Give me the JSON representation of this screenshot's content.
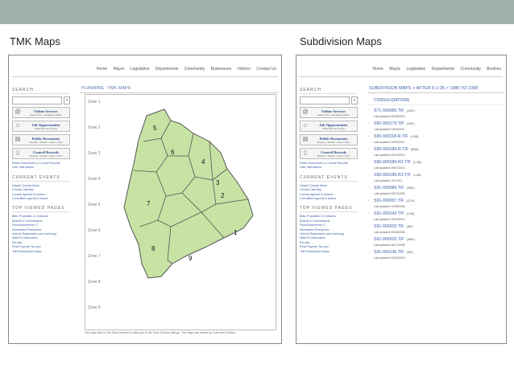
{
  "slide": {
    "left_title": "TMK Maps",
    "right_title": "Subdivision Maps",
    "topbar_color": "#9eb1a9"
  },
  "nav_items": [
    "Home",
    "Mayor",
    "Legislative",
    "Departments",
    "Community",
    "Businesses",
    "Visitors",
    "Contact Us"
  ],
  "nav_items_right": [
    "Home",
    "Mayor",
    "Legislative",
    "Departments",
    "Community",
    "Busines"
  ],
  "sidebar": {
    "search_label": "SEARCH",
    "search_button": "»",
    "services": [
      {
        "icon": "at-sign-icon",
        "glyph": "@",
        "title": "Online Services",
        "sub": "Save Time • Complete Online"
      },
      {
        "icon": "person-icon",
        "glyph": "☺",
        "title": "Job Opportunities",
        "sub": "What Fits the County"
      },
      {
        "icon": "folder-icon",
        "glyph": "▤",
        "title": "Public Documents",
        "sub": "Browse • Search • View • Print"
      },
      {
        "icon": "document-icon",
        "glyph": "▯",
        "title": "Council Records",
        "sub": "Browse • Search • View • Print"
      }
    ],
    "records_links": [
      "Public Documents & Council Records",
      "User Instructions"
    ],
    "current_events_title": "CURRENT EVENTS",
    "current_events": [
      "Hawai'i County News",
      "County Calendar",
      "Council Agenda & Actions",
      "Committee Agenda & Action"
    ],
    "top_viewed_title": "TOP VIEWED PAGES",
    "top_viewed": [
      "Bids, Proposals & Contracts",
      "Boards & Commissions",
      "Fiscal Awareness IT",
      "Information Resources",
      "Vehicle Registration and Licensing",
      "State ID Information",
      "Permits",
      "Real Property Tax and",
      "TMK/Subdivision Maps"
    ]
  },
  "tmk": {
    "heading": "PLANNING : TMK MAPS",
    "zones": [
      "Zone 1",
      "Zone 2",
      "Zone 3",
      "Zone 4",
      "Zone 5",
      "Zone 6",
      "Zone 7",
      "Zone 8",
      "Zone 9"
    ],
    "map_numbers": [
      "1",
      "2",
      "3",
      "4",
      "5",
      "6",
      "7",
      "8",
      "9"
    ],
    "map_fill": "#c6e3a4",
    "map_stroke": "#555555",
    "footer_note": "You may click on the Zone number to take you to the Zone Section listings. The maps are sorted by Zone and Section."
  },
  "subdivision": {
    "heading": "SUBDIVISION MAPS > AFTER 6-1-05 > 1980 TO 1999",
    "consolidations": "CONSOLIDATIONS",
    "files": [
      {
        "name": "S71-000090.TIF",
        "size": "(122K)",
        "date": "Last updated: 05/28/2013"
      },
      {
        "name": "S82-000179.TIF",
        "size": "(105K)",
        "date": "Last updated: 04/04/2007"
      },
      {
        "name": "S90-000118-R.TIF",
        "size": "(1.4M)",
        "date": "Last updated: 04/03/2014"
      },
      {
        "name": "S90-000189-R.TIF",
        "size": "(896K)",
        "date": "Last updated: 05/19/2013"
      },
      {
        "name": "S90-000189-R2.TIF",
        "size": "(1.3M)",
        "date": "Last updated: 09/07/2013"
      },
      {
        "name": "S90-000189-R3.TIF",
        "size": "(1.5M)",
        "date": "Last updated: 10/17/13"
      },
      {
        "name": "S91-000084.TIF",
        "size": "(325K)",
        "date": "Last updated: 03/22/2009"
      },
      {
        "name": "S91-000097.TIF",
        "size": "(117K)",
        "date": "Last updated: 01/28/2008"
      },
      {
        "name": "S91-000143.TIF",
        "size": "(2.4M)",
        "date": "Last updated: 05/10/2012"
      },
      {
        "name": "S91-000202.TIF",
        "size": "(68K)",
        "date": "Last updated: 03/28/2008"
      },
      {
        "name": "S91-000203.TIF",
        "size": "(285K)",
        "date": "Last updated: 06/27/2006"
      },
      {
        "name": "S91-000136.TIF",
        "size": "(90K)",
        "date": "Last updated: 02/06/2013"
      }
    ]
  }
}
